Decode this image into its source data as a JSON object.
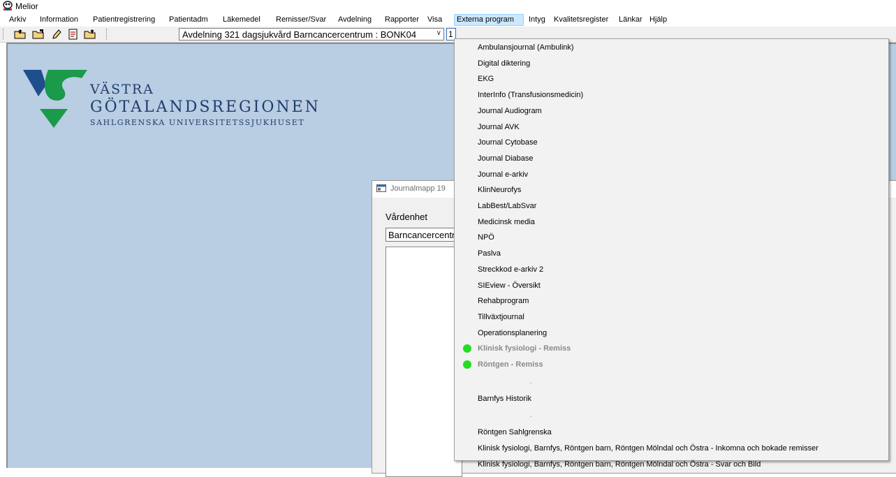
{
  "window": {
    "title": "Melior"
  },
  "menubar": {
    "items": [
      {
        "label": "Arkiv",
        "open": false
      },
      {
        "label": "Information",
        "open": false
      },
      {
        "label": "Patientregistrering",
        "open": false
      },
      {
        "label": "Patientadm",
        "open": false
      },
      {
        "label": "Läkemedel",
        "open": false
      },
      {
        "label": "Remisser/Svar",
        "open": false
      },
      {
        "label": "Avdelning",
        "open": false
      },
      {
        "label": "Rapporter",
        "open": false
      },
      {
        "label": "Visa",
        "open": false
      },
      {
        "label": "Externa program",
        "open": true
      },
      {
        "label": "Intyg",
        "open": false
      },
      {
        "label": "Kvalitetsregister",
        "open": false
      },
      {
        "label": "Länkar",
        "open": false
      },
      {
        "label": "Hjälp",
        "open": false
      }
    ]
  },
  "toolbar": {
    "buttons": [
      "open-folder-icon",
      "open-folder-arrow-icon",
      "pencil-icon",
      "document-edit-icon",
      "folder-export-icon"
    ],
    "department_select": {
      "value": "Avdelning 321 dagsjukvård Barncancercentrum : BONK04"
    },
    "small_field_value": "1"
  },
  "logo": {
    "line1": "VÄSTRA",
    "line2": "GÖTALANDSREGIONEN",
    "line3": "SAHLGRENSKA UNIVERSITETSSJUKHUSET",
    "colors": {
      "blue": "#1f4e8c",
      "green": "#1a9a4a",
      "text": "#1f3e6d"
    }
  },
  "child_window": {
    "title": "Journalmapp 19",
    "vardenhet_label": "Vårdenhet",
    "vardenhet_value": "Barncancercentrum"
  },
  "dropdown": {
    "items": [
      {
        "label": "Ambulansjournal (Ambulink)",
        "enabled": true,
        "status_dot": false
      },
      {
        "label": "Digital diktering",
        "enabled": true,
        "status_dot": false
      },
      {
        "label": "EKG",
        "enabled": true,
        "status_dot": false
      },
      {
        "label": "InterInfo (Transfusionsmedicin)",
        "enabled": true,
        "status_dot": false
      },
      {
        "label": "Journal Audiogram",
        "enabled": true,
        "status_dot": false
      },
      {
        "label": "Journal AVK",
        "enabled": true,
        "status_dot": false
      },
      {
        "label": "Journal Cytobase",
        "enabled": true,
        "status_dot": false
      },
      {
        "label": "Journal Diabase",
        "enabled": true,
        "status_dot": false
      },
      {
        "label": "Journal e-arkiv",
        "enabled": true,
        "status_dot": false
      },
      {
        "label": "KlinNeurofys",
        "enabled": true,
        "status_dot": false
      },
      {
        "label": "LabBest/LabSvar",
        "enabled": true,
        "status_dot": false
      },
      {
        "label": "Medicinsk media",
        "enabled": true,
        "status_dot": false
      },
      {
        "label": "NPÖ",
        "enabled": true,
        "status_dot": false
      },
      {
        "label": "Paslva",
        "enabled": true,
        "status_dot": false
      },
      {
        "label": "Streckkod e-arkiv 2",
        "enabled": true,
        "status_dot": false
      },
      {
        "label": "SIEview - Översikt",
        "enabled": true,
        "status_dot": false
      },
      {
        "label": "Rehabprogram",
        "enabled": true,
        "status_dot": false
      },
      {
        "label": "Tillväxtjournal",
        "enabled": true,
        "status_dot": false
      },
      {
        "label": "Operationsplanering",
        "enabled": true,
        "status_dot": false
      },
      {
        "label": "Klinisk fysiologi - Remiss",
        "enabled": false,
        "status_dot": true
      },
      {
        "label": "Röntgen - Remiss",
        "enabled": false,
        "status_dot": true
      },
      {
        "separator": true
      },
      {
        "label": "Barnfys Historik",
        "enabled": true,
        "status_dot": false
      },
      {
        "separator": true
      },
      {
        "label": "Röntgen Sahlgrenska",
        "enabled": true,
        "status_dot": false
      },
      {
        "label": "Klinisk fysiologi, Barnfys, Röntgen barn, Röntgen Mölndal och Östra - Inkomna och bokade remisser",
        "enabled": true,
        "status_dot": false
      },
      {
        "label": "Klinisk fysiologi, Barnfys, Röntgen barn, Röntgen Mölndal och Östra - Svar och Bild",
        "enabled": true,
        "status_dot": false
      }
    ],
    "status_dot_color": "#22dd22"
  }
}
